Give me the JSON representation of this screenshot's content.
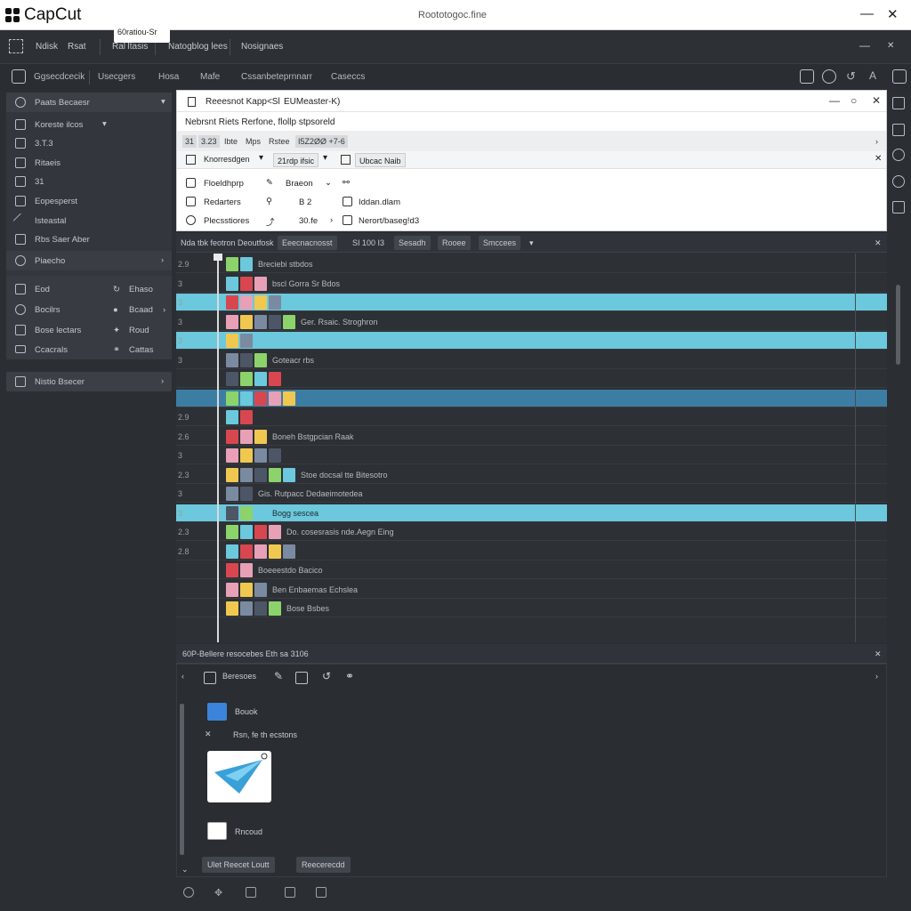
{
  "app": {
    "name": "CapCut",
    "document": "Roototogoc.fine"
  },
  "menu": {
    "items": [
      "Ndisk",
      "Rsat",
      "Ral",
      "Itasis",
      "Natogblog lees",
      "Nosignaes"
    ]
  },
  "toolbar": {
    "items": [
      "Ggsecdcecik",
      "Usecgers",
      "Hosa",
      "Mafe",
      "Cssanbeteprnnarr",
      "Caseccs"
    ]
  },
  "left_panel": {
    "header": "Paats Becaesr",
    "dropdown_value": "60ratiou-Sr",
    "rows": [
      "Koreste ilcos",
      "3.T.3",
      "Ritaeis",
      "31",
      "Eopesperst",
      "Isteastal",
      "Rbs Saer Aber"
    ],
    "section": "Piaecho",
    "grid": [
      [
        "Eod",
        "Ehaso"
      ],
      [
        "Bocilrs",
        "Bcaad"
      ],
      [
        "Bose lectars",
        "Roud"
      ],
      [
        "Ccacrals",
        "Cattas"
      ]
    ],
    "bottom": "Nistio Bsecer"
  },
  "dialog": {
    "title": "Reeesnot Kapp<Sl",
    "title2": "EUMeaster-K)",
    "subtitle": "Nebrsnt Riets Rerfone, flollp stpsoreld",
    "tabs": [
      "31",
      "3.23",
      "Ibte",
      "Mps",
      "Rstee",
      "I5Z2ØØ +7-6"
    ],
    "combo1": "Knorresdgen",
    "combo2": "21rdp ifsic",
    "combo3": "Ubcac Naib",
    "options_left": [
      "Floeldhprp",
      "Redarters",
      "Plecsstiores"
    ],
    "options_mid": [
      "Braeon",
      "B 2",
      "30.fe"
    ],
    "options_right": [
      "Iddan.dlam",
      "Nerort/baseg!d3"
    ]
  },
  "timeline": {
    "tabs": [
      "Nda tbk feotron Deoutfosk",
      "Eeecnacnosst",
      "SI 100 I3",
      "Sesadh",
      "Rooee",
      "Smccees"
    ],
    "tracks": [
      {
        "num": "2.9",
        "label": "Breciebi stbdos",
        "style": "plain"
      },
      {
        "num": "3",
        "label": "bscl Gorra Sr Bdos",
        "style": "plain"
      },
      {
        "num": "3",
        "label": "",
        "style": "cyan"
      },
      {
        "num": "3",
        "label": "Ger. Rsaic. Stroghron",
        "style": "plain"
      },
      {
        "num": "3",
        "label": "",
        "style": "cyan"
      },
      {
        "num": "3",
        "label": "Goteacr rbs",
        "style": "plain"
      },
      {
        "num": "",
        "label": "",
        "style": "plain"
      },
      {
        "num": "",
        "label": "",
        "style": "blue"
      },
      {
        "num": "2.9",
        "label": "",
        "style": "plain"
      },
      {
        "num": "2.6",
        "label": "Boneh Bstgpcian Raak",
        "style": "plain"
      },
      {
        "num": "3",
        "label": "",
        "style": "plain"
      },
      {
        "num": "2.3",
        "label": "Stoe docsal tte Bitesotro",
        "style": "plain"
      },
      {
        "num": "3",
        "label": "Gis. Rutpacc Dedaeimotedea",
        "style": "plain"
      },
      {
        "num": "3",
        "label": "Bogg sescea",
        "style": "cyan"
      },
      {
        "num": "2.3",
        "label": "Do. cosesrasis nde.Aegn Eing",
        "style": "plain"
      },
      {
        "num": "2.8",
        "label": "",
        "style": "plain"
      },
      {
        "num": "",
        "label": "Boeeestdo Bacico",
        "style": "plain"
      },
      {
        "num": "",
        "label": "Ben Enbaemas Echslea",
        "style": "plain"
      },
      {
        "num": "",
        "label": "Bose Bsbes",
        "style": "plain"
      }
    ]
  },
  "bottom_panel": {
    "header": "60P-Bellere resocebes Eth sa 3106",
    "tool_label": "Beresoes",
    "items": [
      "Bouok",
      "Rsn, fe th ecstons",
      "Rncoud"
    ],
    "buttons": [
      "Ulet Reecet Loutt",
      "Reecerecdd"
    ]
  },
  "colors": {
    "accent_cyan": "#6cc8dc",
    "accent_blue": "#3c7ea3",
    "clip_red": "#d8474f"
  }
}
